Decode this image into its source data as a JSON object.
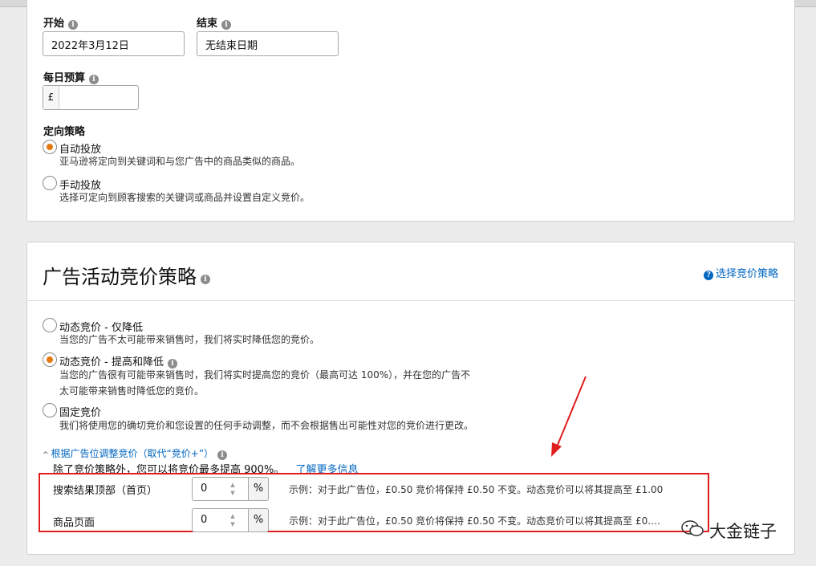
{
  "schedule": {
    "start_label": "开始",
    "start_value": "2022年3月12日",
    "end_label": "结束",
    "end_value": "无结束日期"
  },
  "budget": {
    "label": "每日预算",
    "currency": "£",
    "value": ""
  },
  "targeting": {
    "label": "定向策略",
    "options": [
      {
        "title": "自动投放",
        "desc": "亚马逊将定向到关键词和与您广告中的商品类似的商品。",
        "selected": true
      },
      {
        "title": "手动投放",
        "desc": "选择可定向到顾客搜索的关键词或商品并设置自定义竞价。",
        "selected": false
      }
    ]
  },
  "bidding": {
    "title": "广告活动竞价策略",
    "help_link": "选择竞价策略",
    "options": [
      {
        "title": "动态竞价 - 仅降低",
        "desc": [
          "当您的广告不太可能带来销售时，我们将实时降低您的竞价。"
        ],
        "selected": false
      },
      {
        "title": "动态竞价 - 提高和降低",
        "desc": [
          "当您的广告很有可能带来销售时，我们将实时提高您的竞价（最高可达 100%），并在您的广告不",
          "太可能带来销售时降低您的竞价。"
        ],
        "selected": true
      },
      {
        "title": "固定竞价",
        "desc": [
          "我们将使用您的确切竞价和您设置的任何手动调整，而不会根据售出可能性对您的竞价进行更改。"
        ],
        "selected": false
      }
    ],
    "placement_toggle": "根据广告位调整竞价（取代“竞价+”）",
    "placement_note": "除了竞价策略外，您可以将竞价最多提高 900%。",
    "learn_more": "了解更多信息",
    "placements": [
      {
        "label": "搜索结果顶部（首页）",
        "value": "0",
        "suffix": "%",
        "example": "示例：对于此广告位，£0.50 竞价将保持 £0.50 不变。动态竞价可以将其提高至 £1.00"
      },
      {
        "label": "商品页面",
        "value": "0",
        "suffix": "%",
        "example": "示例：对于此广告位，£0.50 竞价将保持 £0.50 不变。动态竞价可以将其提高至 £0.…"
      }
    ]
  },
  "watermark": "大金链子",
  "colors": {
    "accent": "#e47911",
    "link": "#0066c0",
    "annotation": "#e21d1d"
  }
}
